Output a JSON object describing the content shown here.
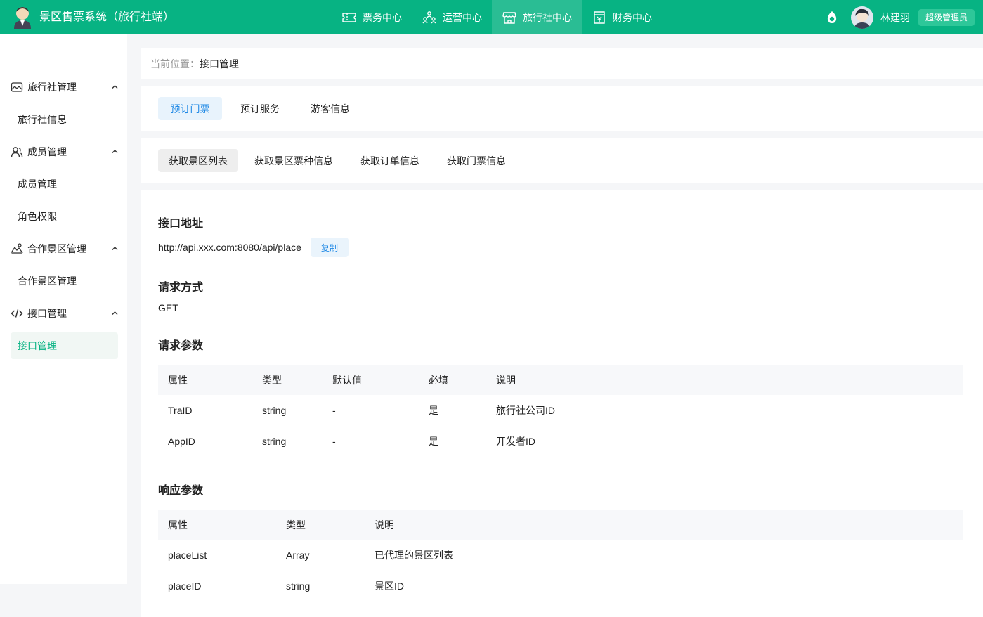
{
  "header": {
    "title": "景区售票系统（旅行社端）",
    "nav": [
      {
        "label": "票务中心",
        "icon": "ticket-icon"
      },
      {
        "label": "运营中心",
        "icon": "people-icon"
      },
      {
        "label": "旅行社中心",
        "icon": "shop-icon",
        "active": true
      },
      {
        "label": "财务中心",
        "icon": "finance-icon"
      }
    ],
    "username": "林建羽",
    "role": "超级管理员"
  },
  "sidebar": {
    "groups": [
      {
        "label": "旅行社管理",
        "icon": "image-icon",
        "items": [
          "旅行社信息"
        ]
      },
      {
        "label": "成员管理",
        "icon": "user-icon",
        "items": [
          "成员管理",
          "角色权限"
        ]
      },
      {
        "label": "合作景区管理",
        "icon": "landscape-icon",
        "items": [
          "合作景区管理"
        ]
      },
      {
        "label": "接口管理",
        "icon": "code-icon",
        "items": [
          "接口管理"
        ]
      }
    ]
  },
  "breadcrumb": {
    "prefix": "当前位置：",
    "current": "接口管理"
  },
  "tabs_primary": [
    "预订门票",
    "预订服务",
    "游客信息"
  ],
  "tabs_secondary": [
    "获取景区列表",
    "获取景区票种信息",
    "获取订单信息",
    "获取门票信息"
  ],
  "api": {
    "address_title": "接口地址",
    "address": "http://api.xxx.com:8080/api/place",
    "copy_label": "复制",
    "method_title": "请求方式",
    "method": "GET",
    "request_title": "请求参数",
    "request_headers": [
      "属性",
      "类型",
      "默认值",
      "必填",
      "说明"
    ],
    "request_rows": [
      [
        "TraID",
        "string",
        "-",
        "是",
        "旅行社公司ID"
      ],
      [
        "AppID",
        "string",
        "-",
        "是",
        "开发者ID"
      ]
    ],
    "response_title": "响应参数",
    "response_headers": [
      "属性",
      "类型",
      "说明"
    ],
    "response_rows": [
      [
        "placeList",
        "Array",
        "已代理的景区列表"
      ],
      [
        "placeID",
        "string",
        "景区ID"
      ]
    ]
  },
  "colors": {
    "brand": "#07b383",
    "accent_blue": "#1e88e5"
  }
}
